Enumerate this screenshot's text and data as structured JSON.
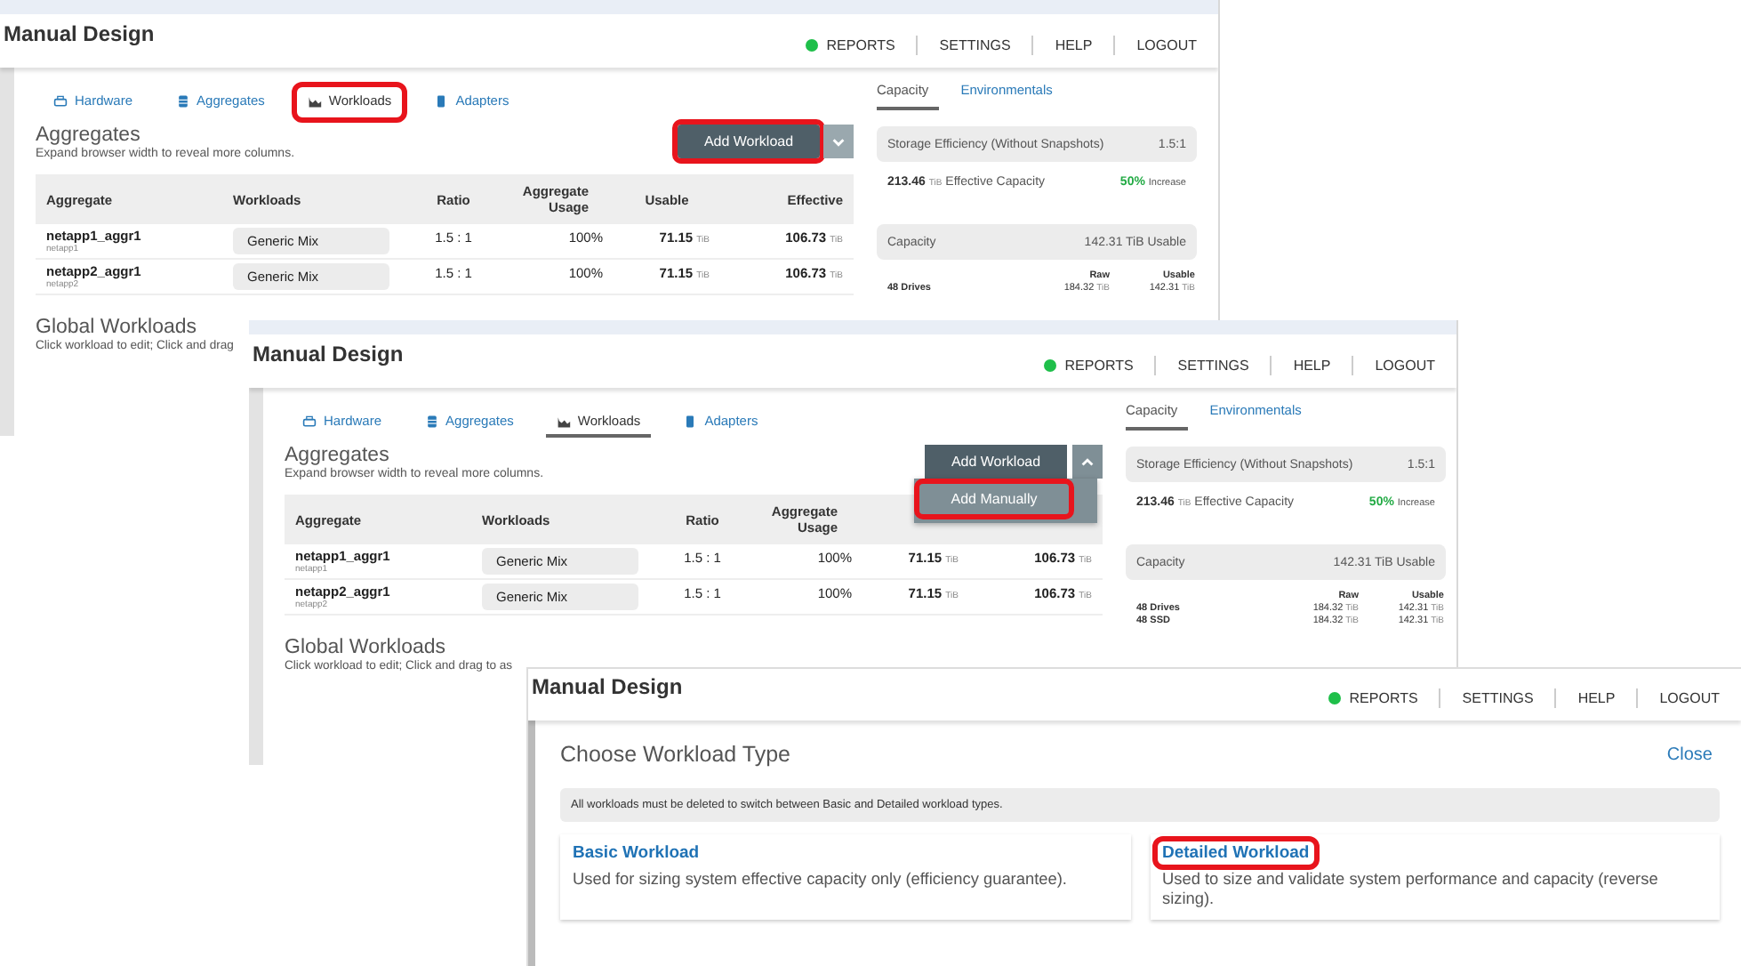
{
  "windows": [
    {
      "kind": "designer",
      "title": "Manual Design",
      "nav": [
        {
          "label": "REPORTS",
          "kind": "status"
        },
        {
          "label": "SETTINGS",
          "kind": "link"
        },
        {
          "label": "HELP",
          "kind": "link"
        },
        {
          "label": "LOGOUT",
          "kind": "link"
        }
      ],
      "tabs": [
        {
          "label": "Hardware",
          "selected": false,
          "highlighted": false
        },
        {
          "label": "Aggregates",
          "selected": false,
          "highlighted": false
        },
        {
          "label": "Workloads",
          "selected": true,
          "highlighted": true
        },
        {
          "label": "Adapters",
          "selected": false,
          "highlighted": false
        }
      ],
      "section": {
        "title": "Aggregates",
        "subtitle": "Expand browser width to reveal more columns."
      },
      "add_workload": {
        "label": "Add Workload",
        "highlighted": true,
        "expanded": false
      },
      "table": {
        "columns": [
          "Aggregate",
          "Workloads",
          "Ratio",
          "Aggregate Usage",
          "Usable",
          "Effective"
        ],
        "rows": [
          {
            "aggregate": "netapp1_aggr1",
            "node": "netapp1",
            "workload": "Generic Mix",
            "ratio": "1.5 : 1",
            "usage": "100%",
            "usable": {
              "value": "71.15",
              "unit": "TiB"
            },
            "effective": {
              "value": "106.73",
              "unit": "TiB"
            }
          },
          {
            "aggregate": "netapp2_aggr1",
            "node": "netapp2",
            "workload": "Generic Mix",
            "ratio": "1.5 : 1",
            "usage": "100%",
            "usable": {
              "value": "71.15",
              "unit": "TiB"
            },
            "effective": {
              "value": "106.73",
              "unit": "TiB"
            }
          }
        ]
      },
      "global": {
        "title": "Global Workloads",
        "subtitle": "Click workload to edit; Click and drag"
      },
      "side_tabs": [
        {
          "label": "Capacity",
          "selected": true
        },
        {
          "label": "Environmentals",
          "selected": false
        }
      ],
      "efficiency": {
        "title": "Storage Efficiency (Without Snapshots)",
        "ratio": "1.5:1",
        "amount": "213.46",
        "unit": "TiB",
        "label": "Effective Capacity",
        "percent": "50%",
        "change": "Increase"
      },
      "capacity": {
        "title": "Capacity",
        "usable": "142.31 TiB Usable",
        "columns": [
          "Raw",
          "Usable"
        ],
        "rows": [
          {
            "label": "48 Drives",
            "raw": {
              "value": "184.32",
              "unit": "TiB"
            },
            "usable": {
              "value": "142.31",
              "unit": "TiB"
            }
          }
        ]
      }
    },
    {
      "kind": "designer",
      "title": "Manual Design",
      "nav": [
        {
          "label": "REPORTS",
          "kind": "status"
        },
        {
          "label": "SETTINGS",
          "kind": "link"
        },
        {
          "label": "HELP",
          "kind": "link"
        },
        {
          "label": "LOGOUT",
          "kind": "link"
        }
      ],
      "tabs": [
        {
          "label": "Hardware",
          "selected": false,
          "highlighted": false
        },
        {
          "label": "Aggregates",
          "selected": false,
          "highlighted": false
        },
        {
          "label": "Workloads",
          "selected": true,
          "highlighted": false
        },
        {
          "label": "Adapters",
          "selected": false,
          "highlighted": false
        }
      ],
      "section": {
        "title": "Aggregates",
        "subtitle": "Expand browser width to reveal more columns."
      },
      "add_workload": {
        "label": "Add Workload",
        "highlighted": false,
        "expanded": true,
        "menu": [
          {
            "label": "Add Manually",
            "highlighted": true
          }
        ]
      },
      "table": {
        "columns": [
          "Aggregate",
          "Workloads",
          "Ratio",
          "Aggregate Usage"
        ],
        "rows": [
          {
            "aggregate": "netapp1_aggr1",
            "node": "netapp1",
            "workload": "Generic Mix",
            "ratio": "1.5 : 1",
            "usage": "100%",
            "usable": {
              "value": "71.15",
              "unit": "TiB"
            },
            "effective": {
              "value": "106.73",
              "unit": "TiB"
            }
          },
          {
            "aggregate": "netapp2_aggr1",
            "node": "netapp2",
            "workload": "Generic Mix",
            "ratio": "1.5 : 1",
            "usage": "100%",
            "usable": {
              "value": "71.15",
              "unit": "TiB"
            },
            "effective": {
              "value": "106.73",
              "unit": "TiB"
            }
          }
        ]
      },
      "global": {
        "title": "Global Workloads",
        "subtitle": "Click workload to edit; Click and drag to as"
      },
      "side_tabs": [
        {
          "label": "Capacity",
          "selected": true
        },
        {
          "label": "Environmentals",
          "selected": false
        }
      ],
      "efficiency": {
        "title": "Storage Efficiency (Without Snapshots)",
        "ratio": "1.5:1",
        "amount": "213.46",
        "unit": "TiB",
        "label": "Effective Capacity",
        "percent": "50%",
        "change": "Increase"
      },
      "capacity": {
        "title": "Capacity",
        "usable": "142.31 TiB Usable",
        "columns": [
          "Raw",
          "Usable"
        ],
        "rows": [
          {
            "label": "48 Drives",
            "raw": {
              "value": "184.32",
              "unit": "TiB"
            },
            "usable": {
              "value": "142.31",
              "unit": "TiB"
            }
          },
          {
            "label": "48 SSD",
            "raw": {
              "value": "184.32",
              "unit": "TiB"
            },
            "usable": {
              "value": "142.31",
              "unit": "TiB"
            }
          }
        ]
      }
    },
    {
      "kind": "chooser",
      "title": "Manual Design",
      "nav": [
        {
          "label": "REPORTS",
          "kind": "status"
        },
        {
          "label": "SETTINGS",
          "kind": "link"
        },
        {
          "label": "HELP",
          "kind": "link"
        },
        {
          "label": "LOGOUT",
          "kind": "link"
        }
      ],
      "dialog": {
        "title": "Choose Workload Type",
        "close": "Close",
        "notice": "All workloads must be deleted to switch between Basic and Detailed workload types.",
        "options": [
          {
            "title": "Basic Workload",
            "description": "Used for sizing system effective capacity only (efficiency guarantee).",
            "highlighted": false
          },
          {
            "title": "Detailed Workload",
            "description": "Used to size and validate system performance and capacity (reverse sizing).",
            "highlighted": true
          }
        ]
      }
    }
  ]
}
